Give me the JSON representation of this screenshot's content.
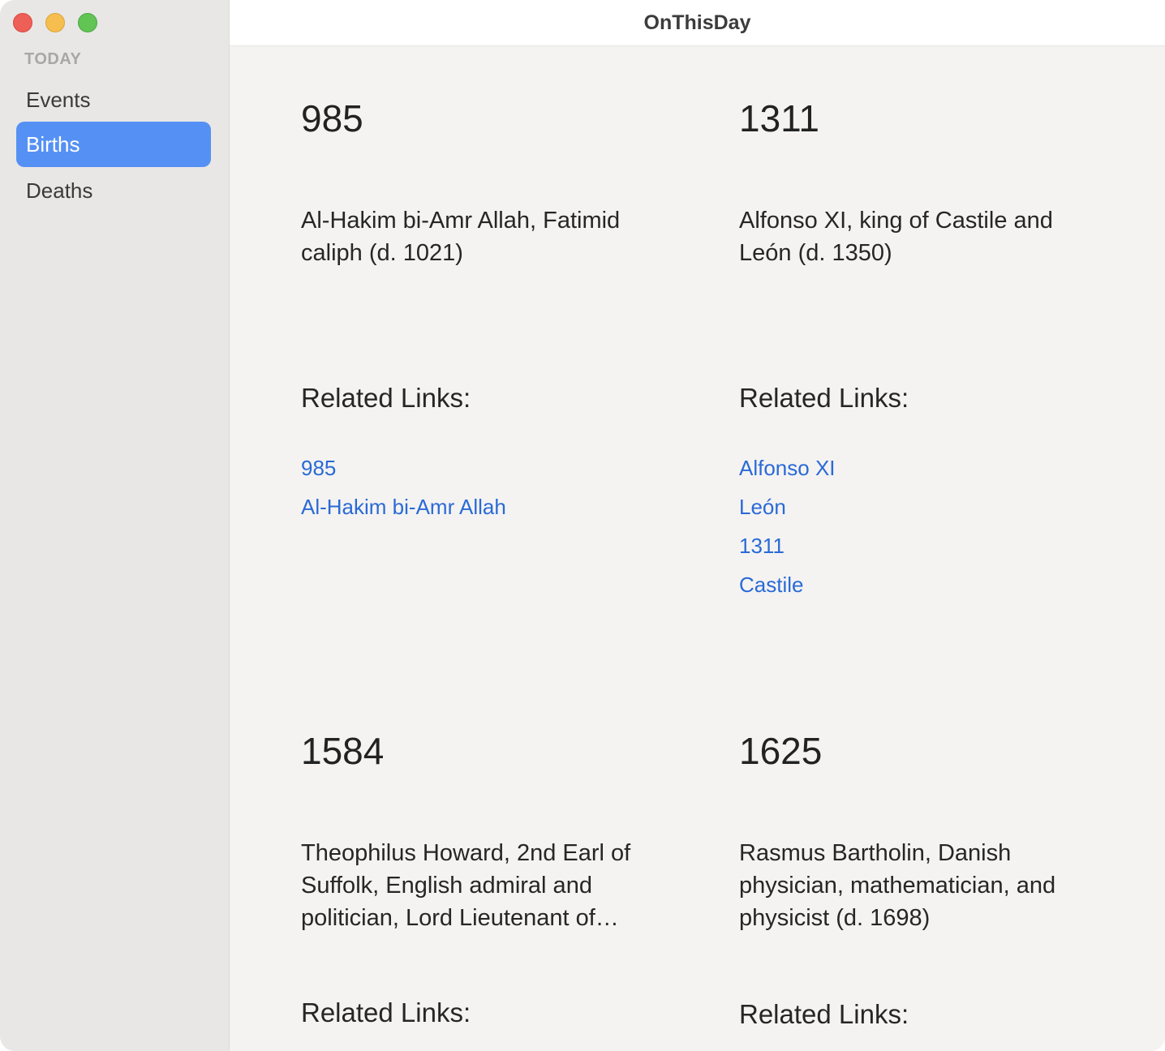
{
  "app": {
    "title": "OnThisDay"
  },
  "sidebar": {
    "section_header": "TODAY",
    "items": [
      {
        "label": "Events"
      },
      {
        "label": "Births"
      },
      {
        "label": "Deaths"
      }
    ],
    "selected": "Births"
  },
  "entries": [
    {
      "year": "985",
      "text": "Al-Hakim bi-Amr Allah, Fatimid caliph (d. 1021)",
      "related_label": "Related Links:",
      "links": [
        "985",
        "Al-Hakim bi-Amr Allah"
      ]
    },
    {
      "year": "1311",
      "text": "Alfonso XI, king of Castile and León (d. 1350)",
      "related_label": "Related Links:",
      "links": [
        "Alfonso XI",
        "León",
        "1311",
        "Castile"
      ]
    },
    {
      "year": "1584",
      "text": "Theophilus Howard, 2nd Earl of Suffolk, English admiral and politician, Lord Lieutenant of…",
      "related_label": "Related Links:",
      "links": []
    },
    {
      "year": "1625",
      "text": "Rasmus Bartholin, Danish physician, mathematician, and physicist (d. 1698)",
      "related_label": "Related Links:",
      "links": []
    }
  ],
  "colors": {
    "accent": "#5591f5",
    "link": "#2a6ad6",
    "sidebar_bg": "#e8e7e6",
    "content_bg": "#f4f3f2"
  }
}
